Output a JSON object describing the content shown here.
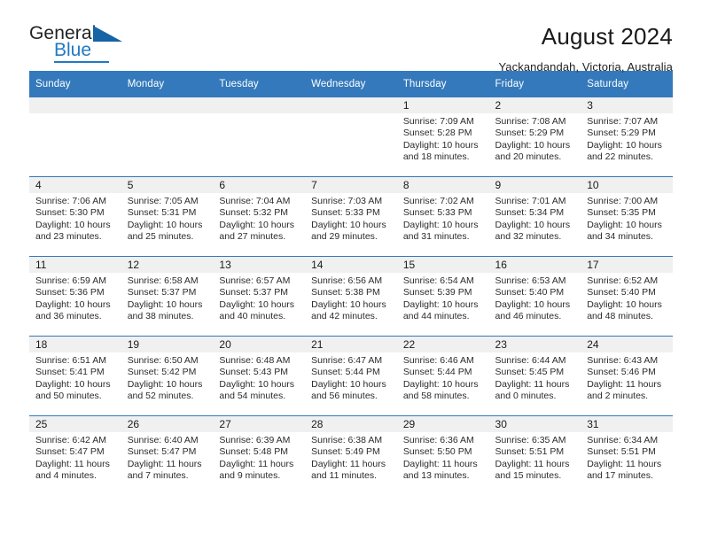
{
  "brand": {
    "name_part1": "General",
    "name_part2": "Blue",
    "accent_color": "#1f7ac4",
    "triangle_color": "#1763a6"
  },
  "header": {
    "title": "August 2024",
    "subtitle": "Yackandandah, Victoria, Australia"
  },
  "calendar": {
    "header_bg": "#3479bb",
    "daynum_bg": "#f0f0f0",
    "weekday_headers": [
      "Sunday",
      "Monday",
      "Tuesday",
      "Wednesday",
      "Thursday",
      "Friday",
      "Saturday"
    ],
    "weeks": [
      [
        {
          "day": "",
          "empty": true,
          "sunrise": "",
          "sunset": "",
          "daylight_line1": "",
          "daylight_line2": ""
        },
        {
          "day": "",
          "empty": true,
          "sunrise": "",
          "sunset": "",
          "daylight_line1": "",
          "daylight_line2": ""
        },
        {
          "day": "",
          "empty": true,
          "sunrise": "",
          "sunset": "",
          "daylight_line1": "",
          "daylight_line2": ""
        },
        {
          "day": "",
          "empty": true,
          "sunrise": "",
          "sunset": "",
          "daylight_line1": "",
          "daylight_line2": ""
        },
        {
          "day": "1",
          "sunrise": "Sunrise: 7:09 AM",
          "sunset": "Sunset: 5:28 PM",
          "daylight_line1": "Daylight: 10 hours",
          "daylight_line2": "and 18 minutes."
        },
        {
          "day": "2",
          "sunrise": "Sunrise: 7:08 AM",
          "sunset": "Sunset: 5:29 PM",
          "daylight_line1": "Daylight: 10 hours",
          "daylight_line2": "and 20 minutes."
        },
        {
          "day": "3",
          "sunrise": "Sunrise: 7:07 AM",
          "sunset": "Sunset: 5:29 PM",
          "daylight_line1": "Daylight: 10 hours",
          "daylight_line2": "and 22 minutes."
        }
      ],
      [
        {
          "day": "4",
          "sunrise": "Sunrise: 7:06 AM",
          "sunset": "Sunset: 5:30 PM",
          "daylight_line1": "Daylight: 10 hours",
          "daylight_line2": "and 23 minutes."
        },
        {
          "day": "5",
          "sunrise": "Sunrise: 7:05 AM",
          "sunset": "Sunset: 5:31 PM",
          "daylight_line1": "Daylight: 10 hours",
          "daylight_line2": "and 25 minutes."
        },
        {
          "day": "6",
          "sunrise": "Sunrise: 7:04 AM",
          "sunset": "Sunset: 5:32 PM",
          "daylight_line1": "Daylight: 10 hours",
          "daylight_line2": "and 27 minutes."
        },
        {
          "day": "7",
          "sunrise": "Sunrise: 7:03 AM",
          "sunset": "Sunset: 5:33 PM",
          "daylight_line1": "Daylight: 10 hours",
          "daylight_line2": "and 29 minutes."
        },
        {
          "day": "8",
          "sunrise": "Sunrise: 7:02 AM",
          "sunset": "Sunset: 5:33 PM",
          "daylight_line1": "Daylight: 10 hours",
          "daylight_line2": "and 31 minutes."
        },
        {
          "day": "9",
          "sunrise": "Sunrise: 7:01 AM",
          "sunset": "Sunset: 5:34 PM",
          "daylight_line1": "Daylight: 10 hours",
          "daylight_line2": "and 32 minutes."
        },
        {
          "day": "10",
          "sunrise": "Sunrise: 7:00 AM",
          "sunset": "Sunset: 5:35 PM",
          "daylight_line1": "Daylight: 10 hours",
          "daylight_line2": "and 34 minutes."
        }
      ],
      [
        {
          "day": "11",
          "sunrise": "Sunrise: 6:59 AM",
          "sunset": "Sunset: 5:36 PM",
          "daylight_line1": "Daylight: 10 hours",
          "daylight_line2": "and 36 minutes."
        },
        {
          "day": "12",
          "sunrise": "Sunrise: 6:58 AM",
          "sunset": "Sunset: 5:37 PM",
          "daylight_line1": "Daylight: 10 hours",
          "daylight_line2": "and 38 minutes."
        },
        {
          "day": "13",
          "sunrise": "Sunrise: 6:57 AM",
          "sunset": "Sunset: 5:37 PM",
          "daylight_line1": "Daylight: 10 hours",
          "daylight_line2": "and 40 minutes."
        },
        {
          "day": "14",
          "sunrise": "Sunrise: 6:56 AM",
          "sunset": "Sunset: 5:38 PM",
          "daylight_line1": "Daylight: 10 hours",
          "daylight_line2": "and 42 minutes."
        },
        {
          "day": "15",
          "sunrise": "Sunrise: 6:54 AM",
          "sunset": "Sunset: 5:39 PM",
          "daylight_line1": "Daylight: 10 hours",
          "daylight_line2": "and 44 minutes."
        },
        {
          "day": "16",
          "sunrise": "Sunrise: 6:53 AM",
          "sunset": "Sunset: 5:40 PM",
          "daylight_line1": "Daylight: 10 hours",
          "daylight_line2": "and 46 minutes."
        },
        {
          "day": "17",
          "sunrise": "Sunrise: 6:52 AM",
          "sunset": "Sunset: 5:40 PM",
          "daylight_line1": "Daylight: 10 hours",
          "daylight_line2": "and 48 minutes."
        }
      ],
      [
        {
          "day": "18",
          "sunrise": "Sunrise: 6:51 AM",
          "sunset": "Sunset: 5:41 PM",
          "daylight_line1": "Daylight: 10 hours",
          "daylight_line2": "and 50 minutes."
        },
        {
          "day": "19",
          "sunrise": "Sunrise: 6:50 AM",
          "sunset": "Sunset: 5:42 PM",
          "daylight_line1": "Daylight: 10 hours",
          "daylight_line2": "and 52 minutes."
        },
        {
          "day": "20",
          "sunrise": "Sunrise: 6:48 AM",
          "sunset": "Sunset: 5:43 PM",
          "daylight_line1": "Daylight: 10 hours",
          "daylight_line2": "and 54 minutes."
        },
        {
          "day": "21",
          "sunrise": "Sunrise: 6:47 AM",
          "sunset": "Sunset: 5:44 PM",
          "daylight_line1": "Daylight: 10 hours",
          "daylight_line2": "and 56 minutes."
        },
        {
          "day": "22",
          "sunrise": "Sunrise: 6:46 AM",
          "sunset": "Sunset: 5:44 PM",
          "daylight_line1": "Daylight: 10 hours",
          "daylight_line2": "and 58 minutes."
        },
        {
          "day": "23",
          "sunrise": "Sunrise: 6:44 AM",
          "sunset": "Sunset: 5:45 PM",
          "daylight_line1": "Daylight: 11 hours",
          "daylight_line2": "and 0 minutes."
        },
        {
          "day": "24",
          "sunrise": "Sunrise: 6:43 AM",
          "sunset": "Sunset: 5:46 PM",
          "daylight_line1": "Daylight: 11 hours",
          "daylight_line2": "and 2 minutes."
        }
      ],
      [
        {
          "day": "25",
          "sunrise": "Sunrise: 6:42 AM",
          "sunset": "Sunset: 5:47 PM",
          "daylight_line1": "Daylight: 11 hours",
          "daylight_line2": "and 4 minutes."
        },
        {
          "day": "26",
          "sunrise": "Sunrise: 6:40 AM",
          "sunset": "Sunset: 5:47 PM",
          "daylight_line1": "Daylight: 11 hours",
          "daylight_line2": "and 7 minutes."
        },
        {
          "day": "27",
          "sunrise": "Sunrise: 6:39 AM",
          "sunset": "Sunset: 5:48 PM",
          "daylight_line1": "Daylight: 11 hours",
          "daylight_line2": "and 9 minutes."
        },
        {
          "day": "28",
          "sunrise": "Sunrise: 6:38 AM",
          "sunset": "Sunset: 5:49 PM",
          "daylight_line1": "Daylight: 11 hours",
          "daylight_line2": "and 11 minutes."
        },
        {
          "day": "29",
          "sunrise": "Sunrise: 6:36 AM",
          "sunset": "Sunset: 5:50 PM",
          "daylight_line1": "Daylight: 11 hours",
          "daylight_line2": "and 13 minutes."
        },
        {
          "day": "30",
          "sunrise": "Sunrise: 6:35 AM",
          "sunset": "Sunset: 5:51 PM",
          "daylight_line1": "Daylight: 11 hours",
          "daylight_line2": "and 15 minutes."
        },
        {
          "day": "31",
          "sunrise": "Sunrise: 6:34 AM",
          "sunset": "Sunset: 5:51 PM",
          "daylight_line1": "Daylight: 11 hours",
          "daylight_line2": "and 17 minutes."
        }
      ]
    ]
  }
}
